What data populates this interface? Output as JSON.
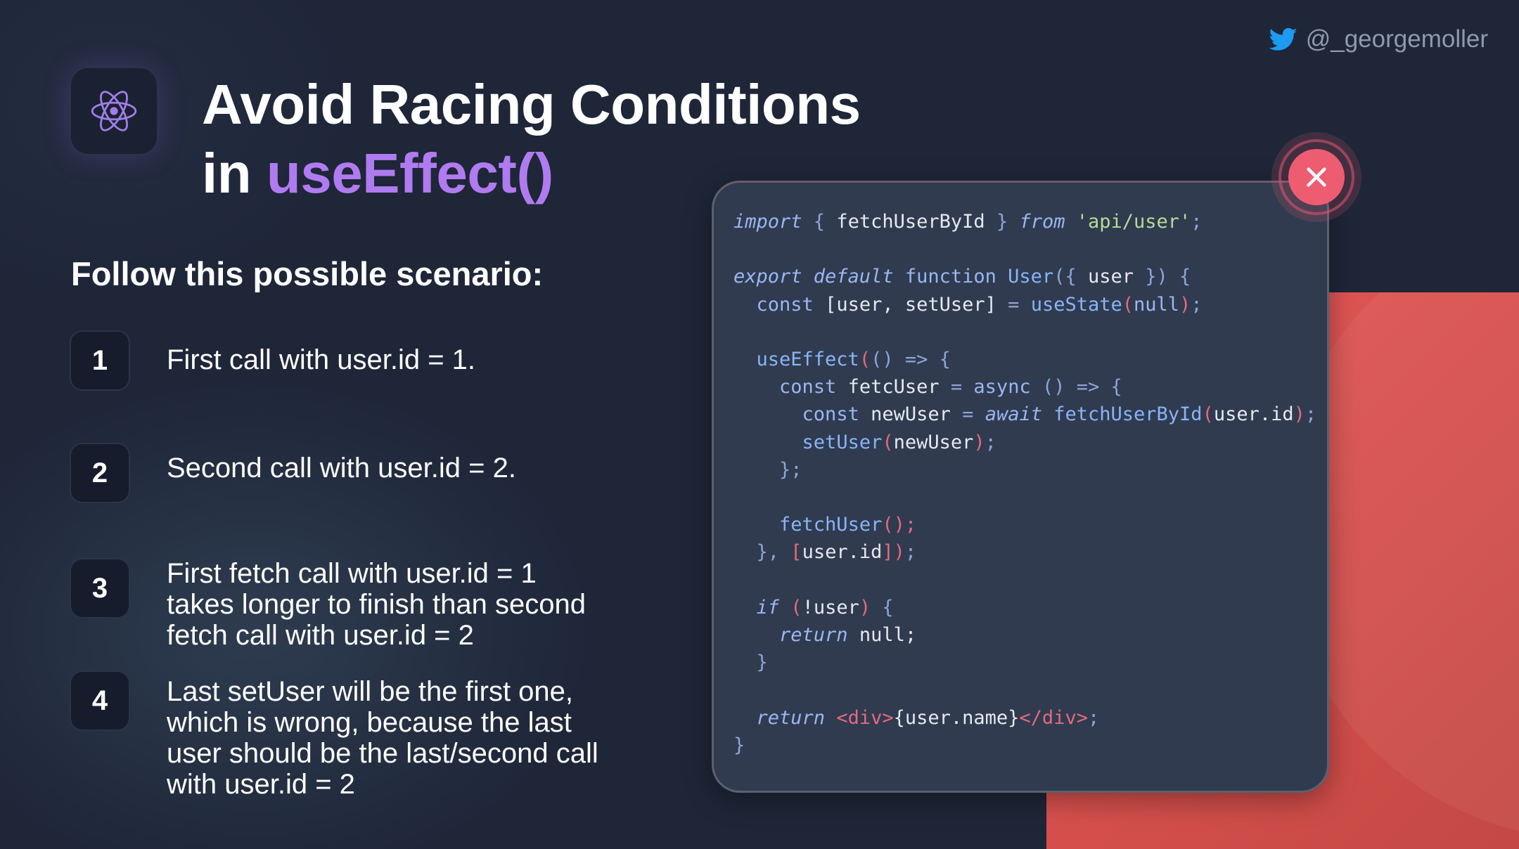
{
  "header": {
    "twitter_handle": "@_georgemoller",
    "title_line1": "Avoid Racing Conditions",
    "title_line2_prefix": "in ",
    "title_line2_accent": "useEffect()"
  },
  "scenario": {
    "heading": "Follow this possible scenario:",
    "steps": [
      {
        "number": "1",
        "text": "First call with user.id = 1."
      },
      {
        "number": "2",
        "text": "Second call with user.id = 2."
      },
      {
        "number": "3",
        "text": "First fetch call with user.id = 1 takes longer to finish than second fetch call with user.id = 2"
      },
      {
        "number": "4",
        "text": "Last setUser will be the first one, which is wrong, because the last user should be the last/second call with user.id = 2"
      }
    ]
  },
  "code": {
    "t": {
      "import": "import",
      "brace_open_sp": " { ",
      "fetchUserById": "fetchUserById",
      "brace_close_sp": " } ",
      "from": "from",
      "api_user": "'api/user'",
      "semi": ";",
      "export_default": "export default",
      "function": "function",
      "User": "User",
      "paren_brace_open": "({",
      "user_sp": " user ",
      "brace_paren_close": "})",
      "brace_open": "{",
      "const": "const",
      "destructure": "[user, setUser]",
      "eq": "=",
      "useState": "useState",
      "paren_open": "(",
      "null": "null",
      "paren_close": ")",
      "useEffect": "useEffect",
      "empty_parens": "()",
      "arrow": "=>",
      "fetcUser": "fetcUser",
      "async": "async",
      "newUser": "newUser",
      "await": "await",
      "user_id": "user.id",
      "setUser": "setUser",
      "brace_close_semi": "};",
      "fetchUser": "fetchUser",
      "paren_semi": "();",
      "brace_close_comma": "},",
      "bracket_open": "[",
      "bracket_close": "]",
      "if": "if",
      "bang": "!",
      "user": "user",
      "return": "return",
      "null_semi": "null;",
      "brace_close": "}",
      "div_open": "<div>",
      "user_name_expr": "{user.name}",
      "div_close": "</div>"
    }
  },
  "colors": {
    "accent_purple": "#b07bf0",
    "close_button": "#ee5c72",
    "red_panel": "#e05552",
    "background": "#1e2638",
    "code_card": "#303b4f"
  },
  "icons": [
    "twitter-icon",
    "react-atom-icon",
    "close-icon"
  ]
}
